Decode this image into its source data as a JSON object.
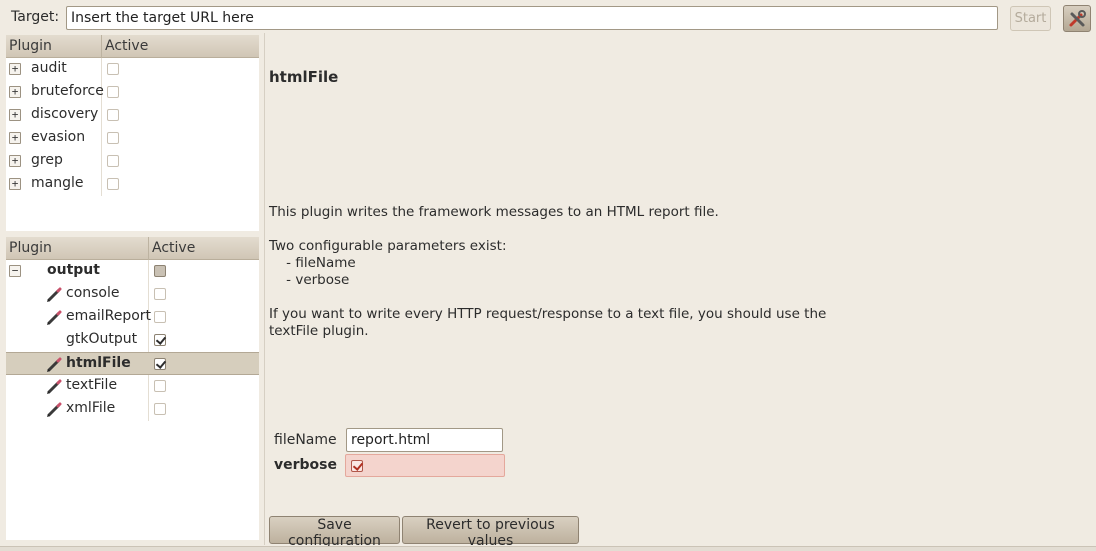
{
  "topbar": {
    "target_label": "Target:",
    "target_placeholder": "Insert the target URL here",
    "start_label": "Start",
    "tools_icon": "wrench-screwdriver-icon"
  },
  "top_tree": {
    "col_plugin": "Plugin",
    "col_active": "Active",
    "rows": [
      {
        "label": "audit",
        "active": false
      },
      {
        "label": "bruteforce",
        "active": false
      },
      {
        "label": "discovery",
        "active": false
      },
      {
        "label": "evasion",
        "active": false
      },
      {
        "label": "grep",
        "active": false
      },
      {
        "label": "mangle",
        "active": false
      }
    ]
  },
  "bottom_tree": {
    "col_plugin": "Plugin",
    "col_active": "Active",
    "group": {
      "label": "output",
      "state": "mixed"
    },
    "rows": [
      {
        "label": "console",
        "active": false,
        "configurable": true,
        "selected": false
      },
      {
        "label": "emailReport",
        "active": false,
        "configurable": true,
        "selected": false
      },
      {
        "label": "gtkOutput",
        "active": true,
        "configurable": false,
        "selected": false
      },
      {
        "label": "htmlFile",
        "active": true,
        "configurable": true,
        "selected": true
      },
      {
        "label": "textFile",
        "active": false,
        "configurable": true,
        "selected": false
      },
      {
        "label": "xmlFile",
        "active": false,
        "configurable": true,
        "selected": false
      }
    ]
  },
  "detail": {
    "title": "htmlFile",
    "desc_1": "This plugin writes the framework messages to an HTML report file.",
    "desc_2": "Two configurable parameters exist:\n    - fileName\n    - verbose",
    "desc_3": "If you want to write every HTTP request/response to a text file, you should use the\ntextFile plugin.",
    "filename_label": "fileName",
    "filename_value": "report.html",
    "verbose_label": "verbose",
    "verbose_checked": true,
    "save_label": "Save configuration",
    "revert_label": "Revert to previous values"
  },
  "colors": {
    "background": "#f0ebe2",
    "header": "#d6cebd",
    "selected_row": "#d6cebd",
    "verbose_highlight": "#f4d4cd"
  }
}
